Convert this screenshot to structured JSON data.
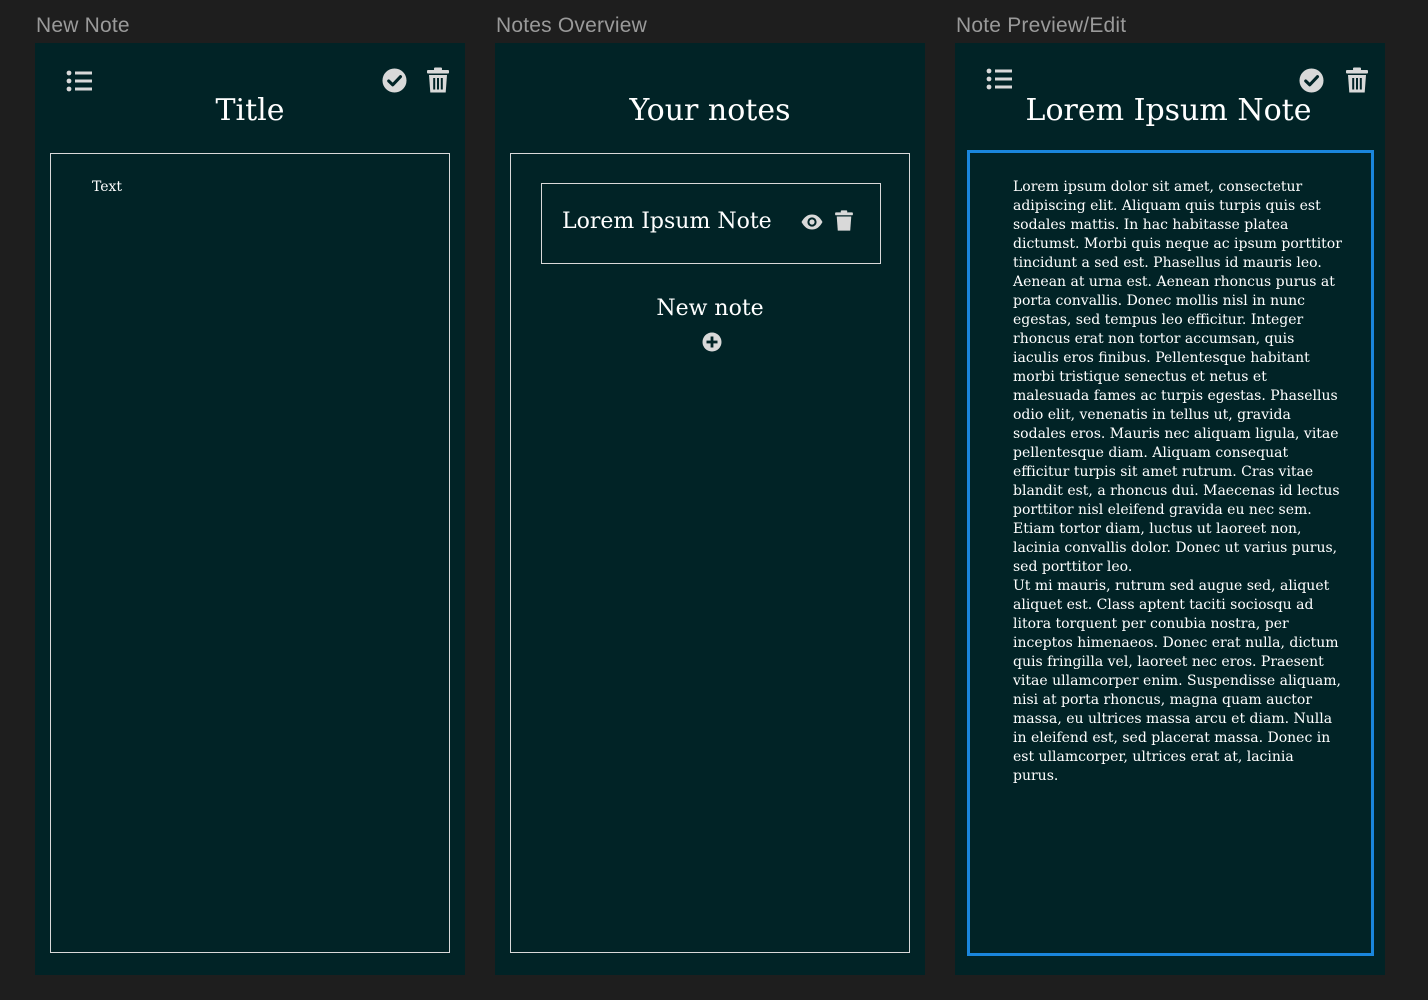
{
  "frames": {
    "new_note": {
      "frame_label": "New Note",
      "title": "Title",
      "text_placeholder": "Text"
    },
    "overview": {
      "frame_label": "Notes Overview",
      "title": "Your notes",
      "notes": [
        {
          "title": "Lorem Ipsum Note"
        }
      ],
      "new_note_label": "New note"
    },
    "preview": {
      "frame_label": "Note Preview/Edit",
      "title": "Lorem Ipsum Note",
      "body": "Lorem ipsum dolor sit amet, consectetur adipiscing elit. Aliquam quis turpis quis est sodales mattis. In hac habitasse platea dictumst. Morbi quis neque ac ipsum porttitor tincidunt a sed est. Phasellus id mauris leo. Aenean at urna est. Aenean rhoncus purus at porta convallis. Donec mollis nisl in nunc egestas, sed tempus leo efficitur. Integer rhoncus erat non tortor accumsan, quis iaculis eros finibus. Pellentesque habitant morbi tristique senectus et netus et malesuada fames ac turpis egestas. Phasellus odio elit, venenatis in tellus ut, gravida sodales eros. Mauris nec aliquam ligula, vitae pellentesque diam. Aliquam consequat efficitur turpis sit amet rutrum. Cras vitae blandit est, a rhoncus dui. Maecenas id lectus porttitor nisl eleifend gravida eu nec sem. Etiam tortor diam, luctus ut laoreet non, lacinia convallis dolor. Donec ut varius purus, sed porttitor leo.\nUt mi mauris, rutrum sed augue sed, aliquet aliquet est. Class aptent taciti sociosqu ad litora torquent per conubia nostra, per inceptos himenaeos. Donec erat nulla, dictum quis fringilla vel, laoreet nec eros. Praesent vitae ullamcorper enim. Suspendisse aliquam, nisi at porta rhoncus, magna quam auctor massa, eu ultrices massa arcu et diam. Nulla in eleifend est, sed placerat massa. Donec in est ullamcorper, ultrices erat at, lacinia purus."
    }
  },
  "icons": {
    "list": "list-icon",
    "check": "check-circle-icon",
    "trash": "trash-icon",
    "eye": "eye-icon",
    "add": "plus-circle-icon"
  },
  "colors": {
    "canvas": "#1e1e1e",
    "frame_bg": "#012326",
    "border": "#d9d9d9",
    "selection": "#1a86dc",
    "icon": "#d9d9d9",
    "text": "#ffffff",
    "frame_label": "#9a9a9a"
  }
}
